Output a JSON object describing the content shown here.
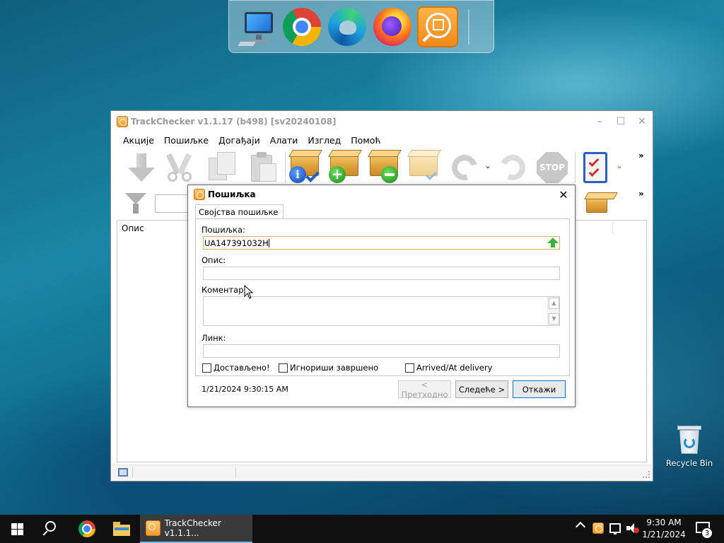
{
  "main_window": {
    "title": "TrackChecker v1.1.17 (b498)  [sv20240108]",
    "menu": [
      "Акције",
      "Пошиљке",
      "Догађаји",
      "Алати",
      "Изглед",
      "Помоћ"
    ],
    "toolbar_stop_label": "STOP",
    "toolbar_more": "»",
    "list_column": "Опис"
  },
  "dialog": {
    "title": "Пошиљка",
    "tab": "Својства пошиљке",
    "fields": {
      "shipment_label": "Пошиљка:",
      "shipment_value": "UA147391032H",
      "description_label": "Опис:",
      "description_value": "",
      "comment_label": "Коментар:",
      "link_label": "Линк:",
      "link_value": ""
    },
    "checkboxes": [
      {
        "label": "Достављено!",
        "checked": false
      },
      {
        "label": "Игнориши завршено",
        "checked": false
      },
      {
        "label": "Arrived/At delivery",
        "checked": false
      }
    ],
    "timestamp": "1/21/2024 9:30:15 AM",
    "buttons": {
      "prev": "< Претходно",
      "next": "Следеће >",
      "cancel": "Откажи"
    }
  },
  "desktop": {
    "recycle_bin": "Recycle Bin"
  },
  "taskbar": {
    "active_task": "TrackChecker v1.1.1...",
    "time": "9:30 AM",
    "date": "1/21/2024",
    "notification_count": "3"
  },
  "colors": {
    "accent": "#0078d7",
    "focus_border": "#d7b25e"
  }
}
